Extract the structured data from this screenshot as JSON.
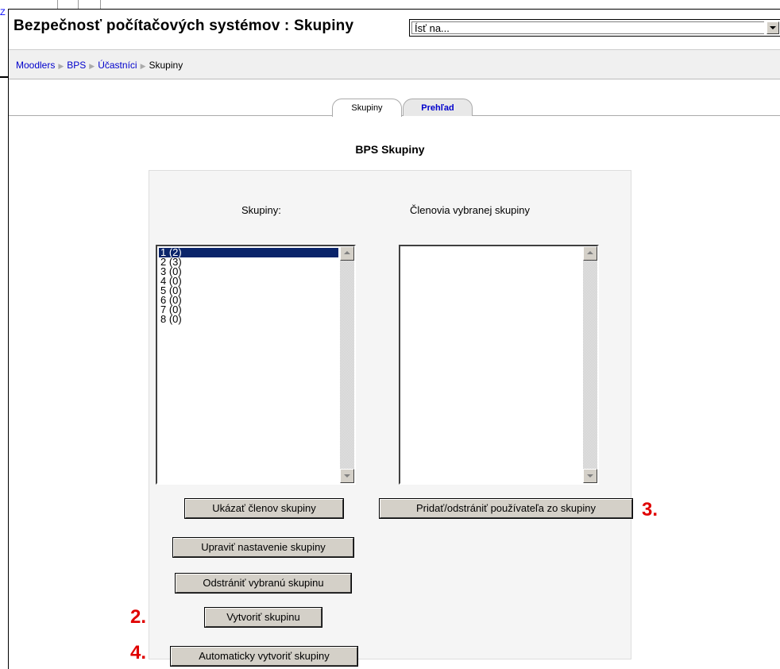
{
  "background": {
    "corner_link": "Z"
  },
  "header": {
    "title": "Bezpečnosť počítačových systémov : Skupiny",
    "jump_select": {
      "value": "Ísť na..."
    }
  },
  "breadcrumb": {
    "items": [
      {
        "label": "Moodlers",
        "link": true
      },
      {
        "label": "BPS",
        "link": true
      },
      {
        "label": "Účastníci",
        "link": true
      },
      {
        "label": "Skupiny",
        "link": false
      }
    ],
    "separator": "▶"
  },
  "tabs": [
    {
      "label": "Skupiny",
      "active": true
    },
    {
      "label": "Prehľad",
      "active": false
    }
  ],
  "section_title": "BPS Skupiny",
  "groups": {
    "left_label": "Skupiny:",
    "right_label": "Členovia vybranej skupiny",
    "list": [
      "1 (2)",
      "2 (3)",
      "3 (0)",
      "4 (0)",
      "5 (0)",
      "6 (0)",
      "7 (0)",
      "8 (0)"
    ],
    "selected_index": 0,
    "members": []
  },
  "buttons": {
    "show_members": "Ukázať členov skupiny",
    "add_remove_user": "Pridať/odstrániť používateľa zo skupiny",
    "edit_settings": "Upraviť nastavenie skupiny",
    "delete_group": "Odstrániť vybranú skupinu",
    "create_group": "Vytvoriť skupinu",
    "auto_create": "Automaticky vytvoriť skupiny"
  },
  "markers": {
    "create": "2.",
    "add_remove": "3.",
    "auto": "4."
  },
  "colors": {
    "marker": "#e00000",
    "link": "#0000cc",
    "selection": "#0a246a"
  }
}
